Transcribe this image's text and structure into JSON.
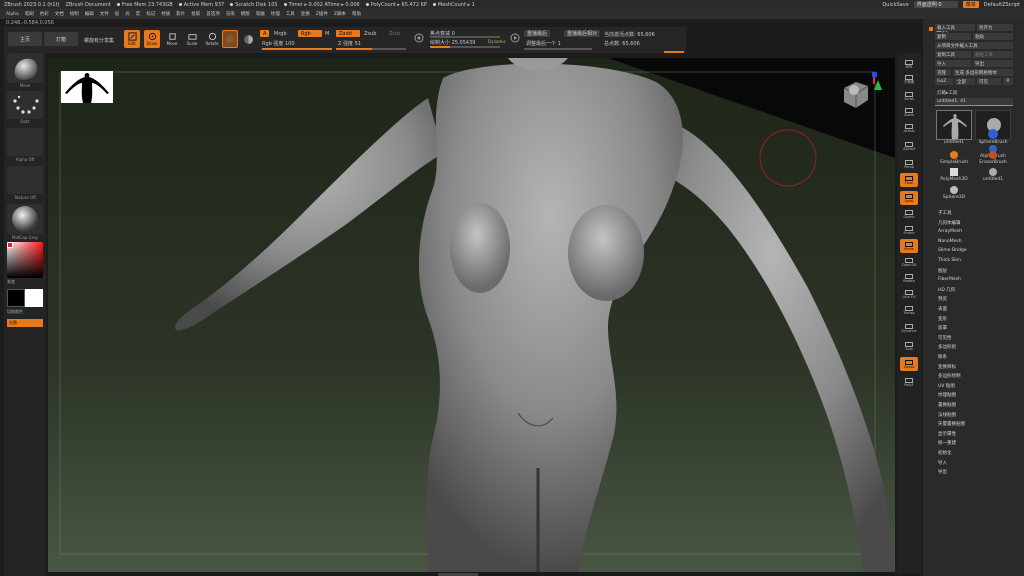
{
  "titlebar": {
    "app": "ZBrush 2023.0.1 (h1t)",
    "document": "ZBrush Document",
    "stats": [
      {
        "label": "Free Mem 23.743GB"
      },
      {
        "label": "Active Mem 937"
      },
      {
        "label": "Scratch Disk 105"
      },
      {
        "label": "Timer ▸ 0.002 ATime ▸ 0.006"
      },
      {
        "label": "PolyCount ▸ 65.472 KP"
      },
      {
        "label": "MeshCount ▸ 1"
      }
    ],
    "quicksave": "QuickSave",
    "transparency": "界面透明 0",
    "menus_btn": "菜单",
    "script": "DefaultZScript"
  },
  "menubar": {
    "items": [
      "Alpha",
      "笔刷",
      "色彩",
      "文档",
      "绘制",
      "编辑",
      "文件",
      "层",
      "光",
      "宏",
      "标记",
      "材质",
      "影片",
      "拾取",
      "首选项",
      "渲染",
      "模版",
      "笔触",
      "纹理",
      "工具",
      "变换",
      "Z插件",
      "Z脚本",
      "帮助"
    ]
  },
  "coords": "0.248,-0.584,0.056",
  "toolbar": {
    "home": "主页",
    "lightbox": "灯箱",
    "quick": "螺旋有分享集",
    "edit": "Edit",
    "draw": "Draw",
    "move": "Move",
    "scale": "Scale",
    "rotate": "Rotate",
    "a_label": "A",
    "mrgb": "Mrgb",
    "rgb": "Rgb",
    "m": "M",
    "rgb_strength": "Rgb 强度 100",
    "zadd": "Zadd",
    "zsub": "Zsub",
    "zcut": "Zcut",
    "z_strength": "Z 强度 51",
    "focal_shift": "焦点衰减 0",
    "draw_size": "绘制大小 25.05439",
    "dynamic": "Dynamic",
    "replay_last": "重播最后",
    "replay_last_rel": "重播最后相对",
    "adjust_last": "调整最后一个 1",
    "active_points": "当前激活点数: 65,606",
    "total_points": "总点数: 65,606"
  },
  "leftshelf": {
    "brush": "Move",
    "stroke": "Dots",
    "alpha": "Alpha Off",
    "texture": "Texture Off",
    "material": "MatCap Gray",
    "gradient": "渐变",
    "switch_color": "切换颜色",
    "alternate": "交替"
  },
  "iconstrip": {
    "buttons": [
      "BPR",
      "子像素",
      "Scroll",
      "Zoom",
      "Actual",
      "AAHalf",
      "Persp",
      "Floor",
      "Local",
      "Gizmo",
      "Frame",
      "Move",
      "Zoom3D",
      "Rotate",
      "Line Fill",
      "Transp",
      "Dynamic",
      "Solo",
      "Xpose",
      "PolyF"
    ]
  },
  "toolpanel": {
    "title": "工具",
    "load": "载入工具",
    "save_as": "另存为",
    "copy": "复制",
    "paste": "粘贴",
    "import_from_project": "从项目文件载入工具",
    "copy_tool": "复制工具",
    "paste_tool": "粘贴工具",
    "import": "导入",
    "export": "导出",
    "clone": "克隆",
    "make_polymesh": "生成 多边形网格物体",
    "goz": "GoZ",
    "all": "全部",
    "visible": "可见",
    "r": "R",
    "lightbox_tools": "灯箱▸工具",
    "current_tool": "untitled1. 41",
    "tools": [
      {
        "name": "untitled1"
      },
      {
        "name": "SphereBrush"
      },
      {
        "name": "AlphaBrush"
      },
      {
        "name": "SimpleBrush"
      },
      {
        "name": "EraserBrush"
      },
      {
        "name": "PolyMesh3D"
      },
      {
        "name": "untitled1"
      },
      {
        "name": "Sphere3D"
      }
    ],
    "subpalettes": [
      "子工具",
      "几何体编辑",
      "ArrayMesh",
      "NanoMesh",
      "Slime Bridge",
      "Thick Skin",
      "图层",
      "FiberMesh",
      "HD 几何",
      "预览",
      "表面",
      "变形",
      "遮罩",
      "可见性",
      "多边形组",
      "联系",
      "变换目标",
      "多边形绘制",
      "UV 贴图",
      "纹理贴图",
      "置换贴图",
      "法线贴图",
      "矢量置换贴图",
      "显示属性",
      "统一重建",
      "初始化",
      "导入",
      "导出"
    ]
  },
  "colors": {
    "accent": "#e87a1e",
    "panel": "#2a2a2a",
    "viewport_bg": "#0f0f0f"
  }
}
